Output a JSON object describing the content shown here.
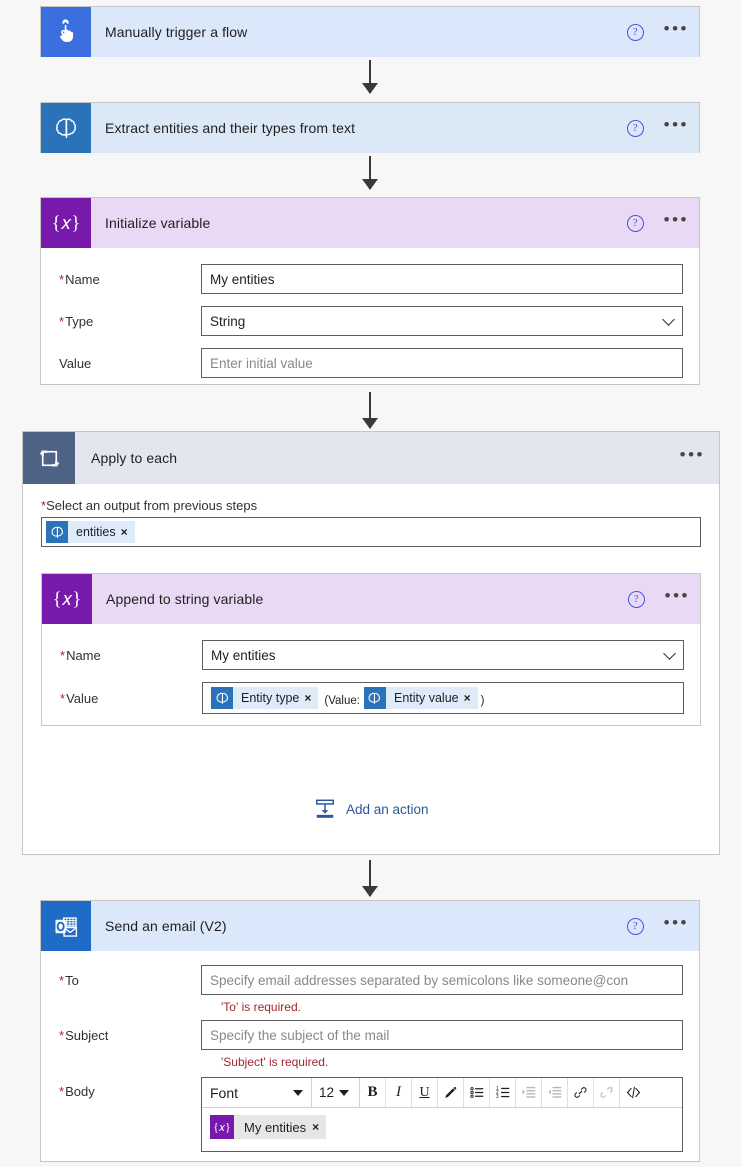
{
  "flow": {
    "steps": [
      {
        "id": "trigger",
        "title": "Manually trigger a flow",
        "icon": "hand-tap-icon",
        "help_label": "?",
        "menu_label": "•••"
      },
      {
        "id": "extract-entities",
        "title": "Extract entities and their types from text",
        "icon": "ai-brain-icon",
        "help_label": "?",
        "menu_label": "•••"
      },
      {
        "id": "initialize-variable",
        "title": "Initialize variable",
        "icon": "variable-icon",
        "help_label": "?",
        "menu_label": "•••",
        "fields": {
          "name_label": "Name",
          "name_value": "My entities",
          "type_label": "Type",
          "type_value": "String",
          "value_label": "Value",
          "value_placeholder": "Enter initial value"
        }
      },
      {
        "id": "apply-to-each",
        "title": "Apply to each",
        "icon": "loop-icon",
        "menu_label": "•••",
        "output_label": "Select an output from previous steps",
        "output_token": {
          "label": "entities",
          "icon": "ai-brain-icon",
          "remove": "×"
        },
        "add_action_label": "Add an action",
        "child": {
          "id": "append-to-string-variable",
          "title": "Append to string variable",
          "icon": "variable-icon",
          "help_label": "?",
          "menu_label": "•••",
          "fields": {
            "name_label": "Name",
            "name_value": "My entities",
            "value_label": "Value",
            "value_tokens": [
              {
                "label": "Entity type",
                "icon": "ai-brain-icon",
                "remove": "×"
              },
              {
                "label": "Entity value",
                "icon": "ai-brain-icon",
                "remove": "×"
              }
            ],
            "value_text_before": "(Value:",
            "value_text_after": ")"
          }
        }
      },
      {
        "id": "send-email",
        "title": "Send an email (V2)",
        "icon": "outlook-icon",
        "help_label": "?",
        "menu_label": "•••",
        "fields": {
          "to_label": "To",
          "to_placeholder": "Specify email addresses separated by semicolons like someone@con",
          "to_error": "'To' is required.",
          "subject_label": "Subject",
          "subject_placeholder": "Specify the subject of the mail",
          "subject_error": "'Subject' is required.",
          "body_label": "Body",
          "body_token": {
            "label": "My entities",
            "icon": "variable-icon",
            "remove": "×"
          }
        },
        "rte": {
          "font_label": "Font",
          "size_label": "12",
          "bold_label": "B",
          "italic_label": "I",
          "underline_label": "U",
          "buttons": [
            "bold-button",
            "italic-button",
            "underline-button",
            "text-color-button",
            "bulleted-list-button",
            "numbered-list-button",
            "increase-indent-button",
            "decrease-indent-button",
            "insert-link-button",
            "remove-link-button",
            "code-view-button"
          ]
        }
      }
    ]
  },
  "colors": {
    "trigger_icon": "#3b6fe0",
    "ai_icon": "#2a73b8",
    "variable_icon": "#7719aa",
    "loop_icon": "#4d6285",
    "outlook_icon": "#1f6bc8",
    "header_blue": "#dbe8fb",
    "header_purple": "#ead9f5",
    "header_gray": "#e3e6ef",
    "error_text": "#a4262c",
    "link_blue": "#2b579a",
    "canvas_bg": "#f7f7f7"
  }
}
